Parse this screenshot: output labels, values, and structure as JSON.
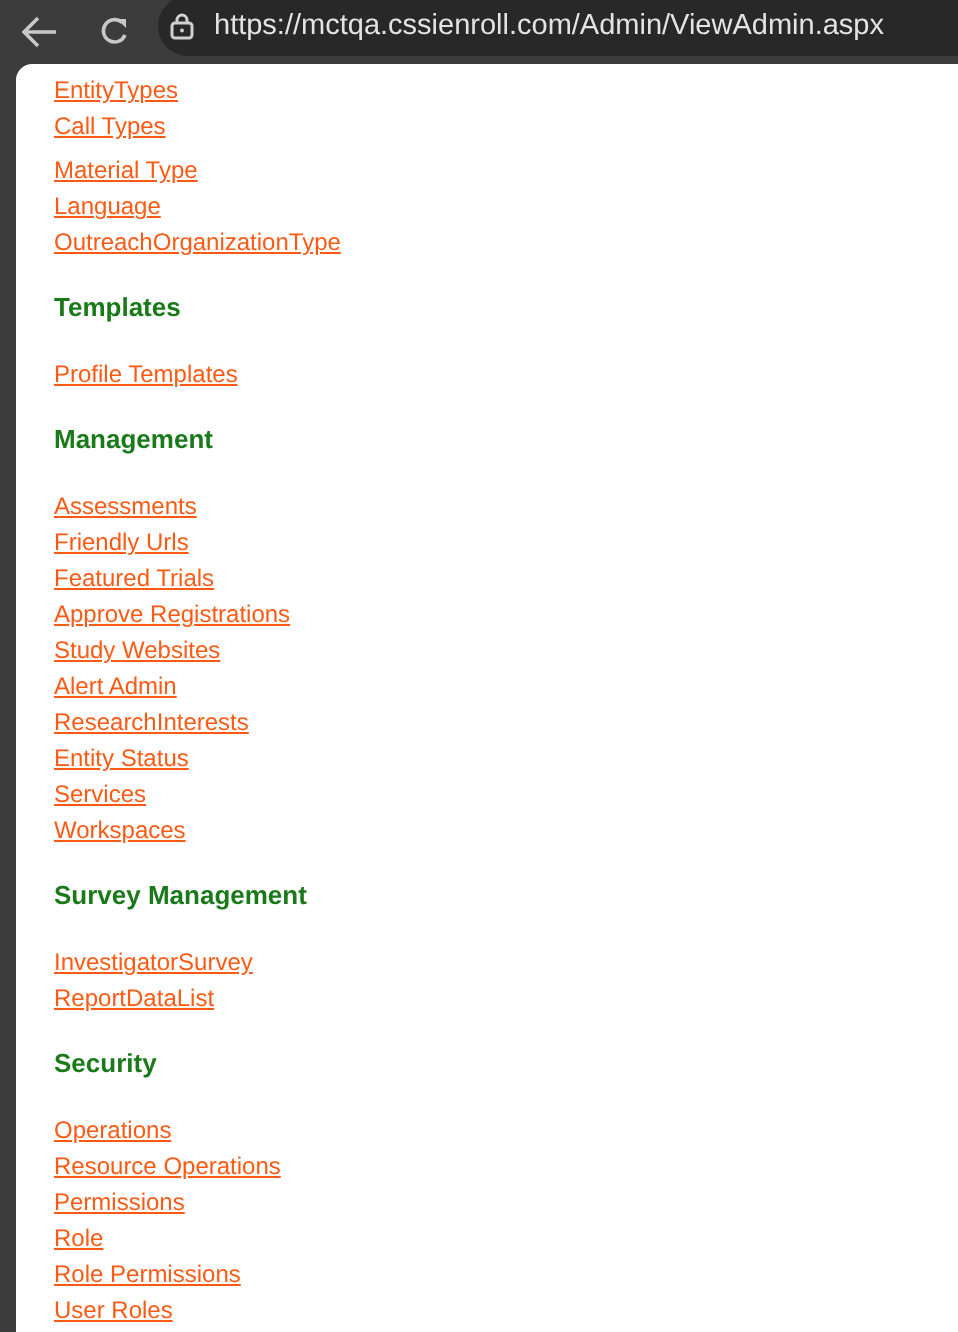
{
  "browser": {
    "url": "https://mctqa.cssienroll.com/Admin/ViewAdmin.aspx"
  },
  "sections": [
    {
      "links": [
        "EntityTypes",
        "Call Types"
      ]
    },
    {
      "links": [
        "Material Type",
        "Language",
        "OutreachOrganizationType"
      ]
    },
    {
      "title": "Templates",
      "links": [
        "Profile Templates"
      ]
    },
    {
      "title": "Management",
      "links": [
        "Assessments",
        "Friendly Urls",
        "Featured Trials",
        "Approve Registrations",
        "Study Websites",
        "Alert Admin",
        "ResearchInterests",
        "Entity Status",
        "Services",
        "Workspaces"
      ]
    },
    {
      "title": "Survey Management",
      "links": [
        "InvestigatorSurvey",
        "ReportDataList"
      ]
    },
    {
      "title": "Security",
      "links": [
        "Operations",
        "Resource Operations",
        "Permissions",
        "Role",
        "Role Permissions",
        "User Roles"
      ]
    }
  ]
}
